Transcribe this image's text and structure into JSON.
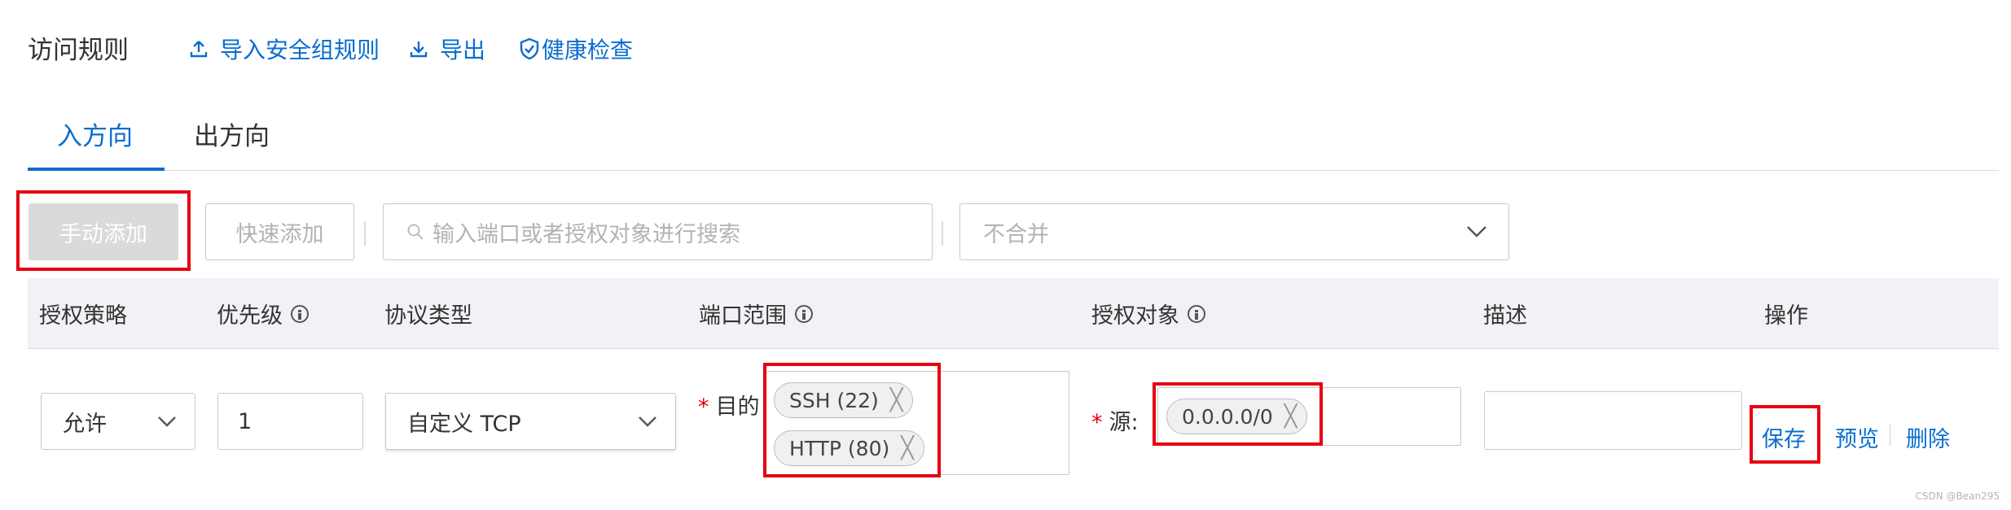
{
  "header": {
    "title": "访问规则",
    "import_label": "导入安全组规则",
    "export_label": "导出",
    "health_label": "健康检查"
  },
  "tabs": [
    {
      "label": "入方向",
      "active": true
    },
    {
      "label": "出方向",
      "active": false
    }
  ],
  "toolbar": {
    "manual_add": "手动添加",
    "quick_add": "快速添加",
    "search_placeholder": "输入端口或者授权对象进行搜索",
    "merge_select": "不合并"
  },
  "table": {
    "columns": [
      "授权策略",
      "优先级",
      "协议类型",
      "端口范围",
      "授权对象",
      "描述",
      "操作"
    ],
    "row": {
      "policy": "允许",
      "priority": "1",
      "protocol": "自定义 TCP",
      "dest_label": "目的",
      "dest_ports": [
        "SSH (22)",
        "HTTP (80)"
      ],
      "source_label": "源:",
      "sources": [
        "0.0.0.0/0"
      ],
      "description": "",
      "actions": {
        "save": "保存",
        "preview": "预览",
        "delete": "删除"
      }
    }
  },
  "required_mark": "*",
  "watermark": "CSDN @Bean295",
  "colors": {
    "accent": "#0a6dcf",
    "highlight": "#e60012"
  }
}
